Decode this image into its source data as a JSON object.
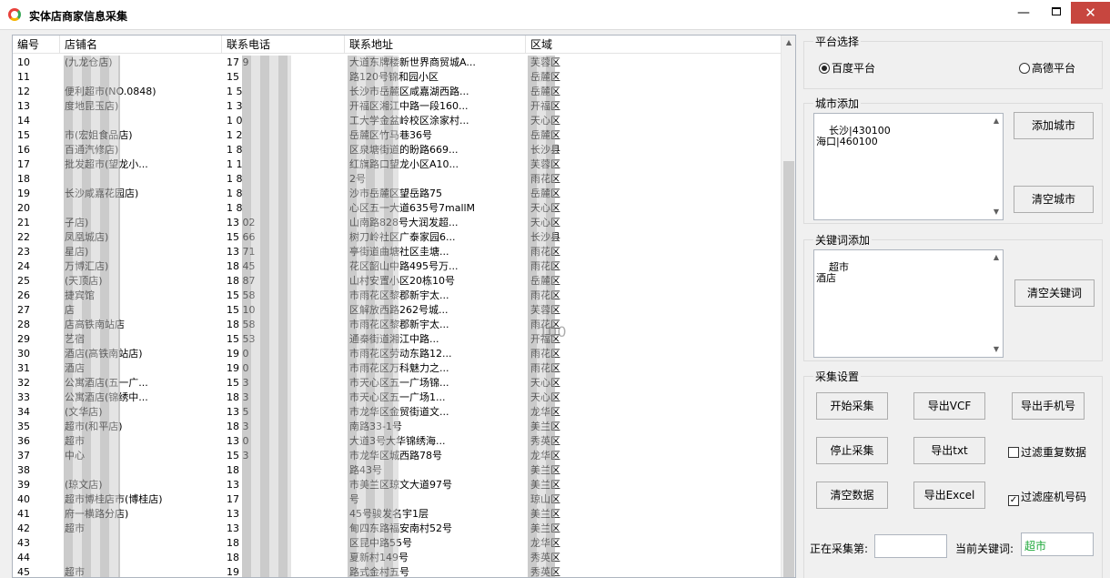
{
  "window": {
    "title": "实体店商家信息采集",
    "minimize_glyph": "—",
    "close_glyph": "✕"
  },
  "colors": {
    "close_bg": "#c7463f",
    "keyword_text": "#1ea83a"
  },
  "list": {
    "headers": [
      "编号",
      "店铺名",
      "联系电话",
      "联系地址",
      "区域"
    ],
    "watermark": "100",
    "rows": [
      {
        "id": "10",
        "name": "(九龙仓店)",
        "phone": "17 9",
        "addr": "大道东牌楼新世界商贸城A...",
        "area": "芙蓉区"
      },
      {
        "id": "11",
        "name": "",
        "phone": "15",
        "addr": "路120号锦和园小区",
        "area": "岳麓区"
      },
      {
        "id": "12",
        "name": "便利超市(NO.0848)",
        "phone": "1 5",
        "addr": "长沙市岳麓区咸嘉湖西路...",
        "area": "岳麓区"
      },
      {
        "id": "13",
        "name": "度地昆玉店)",
        "phone": "1 3",
        "addr": "开福区湘江中路一段160...",
        "area": "开福区"
      },
      {
        "id": "14",
        "name": "",
        "phone": "1 0",
        "addr": "工大学金盆岭校区涂家村...",
        "area": "天心区"
      },
      {
        "id": "15",
        "name": "市(宏姐食品店)",
        "phone": "1 2",
        "addr": "岳麓区竹马巷36号",
        "area": "岳麓区"
      },
      {
        "id": "16",
        "name": "百通汽修店)",
        "phone": "1 8",
        "addr": "区泉塘街道的盼路669...",
        "area": "长沙县"
      },
      {
        "id": "17",
        "name": "批发超市(望龙小...",
        "phone": "1 1",
        "addr": "红旗路口望龙小区A10...",
        "area": "芙蓉区"
      },
      {
        "id": "18",
        "name": "",
        "phone": "1 8",
        "addr": "2号",
        "area": "雨花区"
      },
      {
        "id": "19",
        "name": "长沙咸嘉花园店)",
        "phone": "1 8",
        "addr": "沙市岳麓区望岳路75",
        "area": "岳麓区"
      },
      {
        "id": "20",
        "name": "",
        "phone": "1 8",
        "addr": "心区五一大道635号7mallM",
        "area": "天心区"
      },
      {
        "id": "21",
        "name": "子店)",
        "phone": "13 02",
        "addr": "山南路828号大润发超...",
        "area": "天心区"
      },
      {
        "id": "22",
        "name": "凤凰城店)",
        "phone": "15 66",
        "addr": "树刀岭社区广泰家园6...",
        "area": "长沙县"
      },
      {
        "id": "23",
        "name": "星店)",
        "phone": "13 71",
        "addr": "亭街道曲塘社区圭塘...",
        "area": "雨花区"
      },
      {
        "id": "24",
        "name": "万博汇店)",
        "phone": "18 45",
        "addr": "花区韶山中路495号万...",
        "area": "雨花区"
      },
      {
        "id": "25",
        "name": "(天顶店)",
        "phone": "18 87",
        "addr": "山村安置小区20栋10号",
        "area": "岳麓区"
      },
      {
        "id": "26",
        "name": "捷宾馆",
        "phone": "15 58",
        "addr": "市雨花区黎郡新宇太...",
        "area": "雨花区"
      },
      {
        "id": "27",
        "name": "店",
        "phone": "15 10",
        "addr": "区解放西路262号城...",
        "area": "芙蓉区"
      },
      {
        "id": "28",
        "name": "店高铁南站店",
        "phone": "18 58",
        "addr": "市雨花区黎郡新宇太...",
        "area": "雨花区"
      },
      {
        "id": "29",
        "name": "艺宿",
        "phone": "15 53",
        "addr": "通秦街道湘江中路...",
        "area": "开福区"
      },
      {
        "id": "30",
        "name": "酒店(高铁南站店)",
        "phone": "19 0",
        "addr": "市雨花区劳动东路12...",
        "area": "雨花区"
      },
      {
        "id": "31",
        "name": "酒店",
        "phone": "19 0",
        "addr": "市雨花区万科魅力之...",
        "area": "雨花区"
      },
      {
        "id": "32",
        "name": "公寓酒店(五一广...",
        "phone": "15 3",
        "addr": "市天心区五一广场锦...",
        "area": "天心区"
      },
      {
        "id": "33",
        "name": "公寓酒店(锦绣中...",
        "phone": "18 3",
        "addr": "市天心区五一广场1...",
        "area": "天心区"
      },
      {
        "id": "34",
        "name": "(文华店)",
        "phone": "13 5",
        "addr": "市龙华区金贸街道文...",
        "area": "龙华区"
      },
      {
        "id": "35",
        "name": "超市(和平店)",
        "phone": "18 3",
        "addr": "南路33-1号",
        "area": "美兰区"
      },
      {
        "id": "36",
        "name": "超市",
        "phone": "13 0",
        "addr": "大道3号大华锦绣海...",
        "area": "秀英区"
      },
      {
        "id": "37",
        "name": "中心",
        "phone": "15 3",
        "addr": "市龙华区城西路78号",
        "area": "龙华区"
      },
      {
        "id": "38",
        "name": "",
        "phone": "18",
        "addr": "路43号",
        "area": "美兰区"
      },
      {
        "id": "39",
        "name": "(琼文店)",
        "phone": "13",
        "addr": "市美兰区琼文大道97号",
        "area": "美兰区"
      },
      {
        "id": "40",
        "name": "超市博桂店市(博桂店)",
        "phone": "17",
        "addr": "号",
        "area": "琼山区"
      },
      {
        "id": "41",
        "name": "府一横路分店)",
        "phone": "13",
        "addr": "45号骏发名宇1层",
        "area": "美兰区"
      },
      {
        "id": "42",
        "name": "超市",
        "phone": "13",
        "addr": "甸四东路福安南村52号",
        "area": "美兰区"
      },
      {
        "id": "43",
        "name": "",
        "phone": "18",
        "addr": "区昆中路55号",
        "area": "龙华区"
      },
      {
        "id": "44",
        "name": "",
        "phone": "18",
        "addr": "夏新村149号",
        "area": "秀英区"
      },
      {
        "id": "45",
        "name": "超市",
        "phone": "19",
        "addr": "路式金村五号",
        "area": "秀英区"
      }
    ]
  },
  "platform": {
    "label": "平台选择",
    "option_baidu": "百度平台",
    "option_gaode": "高德平台",
    "selected": "百度平台"
  },
  "city": {
    "label": "城市添加",
    "textarea_value": "长沙|430100\n海口|460100",
    "add_button": "添加城市",
    "clear_button": "清空城市"
  },
  "keyword": {
    "label": "关键词添加",
    "textarea_value": "超市\n酒店",
    "clear_button": "清空关键词"
  },
  "collect": {
    "label": "采集设置",
    "start_button": "开始采集",
    "export_vcf": "导出VCF",
    "export_phone": "导出手机号",
    "stop_button": "停止采集",
    "export_txt": "导出txt",
    "filter_dup_label": "过滤重复数据",
    "filter_dup_checked": false,
    "clear_data": "清空数据",
    "export_excel": "导出Excel",
    "filter_landline_label": "过滤座机号码",
    "filter_landline_checked": true,
    "progress_label": "正在采集第:",
    "progress_value": "",
    "current_keyword_label": "当前关键词:",
    "current_keyword_value": "超市"
  }
}
